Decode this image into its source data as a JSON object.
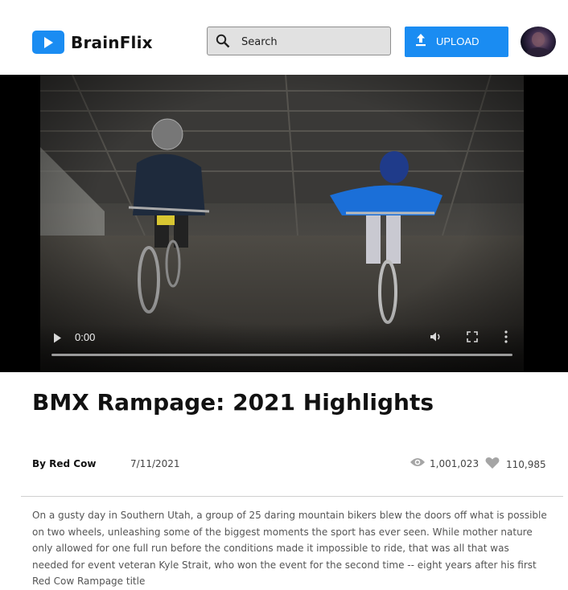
{
  "brand": {
    "name": "BrainFlix",
    "accent": "#1a8cf2"
  },
  "search": {
    "placeholder": "Search",
    "icon": "search-icon"
  },
  "upload": {
    "label": "UPLOAD",
    "icon": "upload-icon"
  },
  "video": {
    "current_time": "0:00",
    "controls": [
      "play-icon",
      "volume-icon",
      "fullscreen-icon",
      "more-options-icon"
    ]
  },
  "title": "BMX Rampage: 2021 Highlights",
  "meta": {
    "author": "By Red Cow",
    "date": "7/11/2021",
    "views": "1,001,023",
    "likes": "110,985"
  },
  "description": "On a gusty day in Southern Utah, a group of 25 daring mountain bikers blew the doors off what is possible on two wheels, unleashing some of the biggest moments the sport has ever seen. While mother nature only allowed for one full run before the conditions made it impossible to ride, that was all that was needed for event veteran Kyle Strait, who won the event for the second time -- eight years after his first Red Cow Rampage title"
}
